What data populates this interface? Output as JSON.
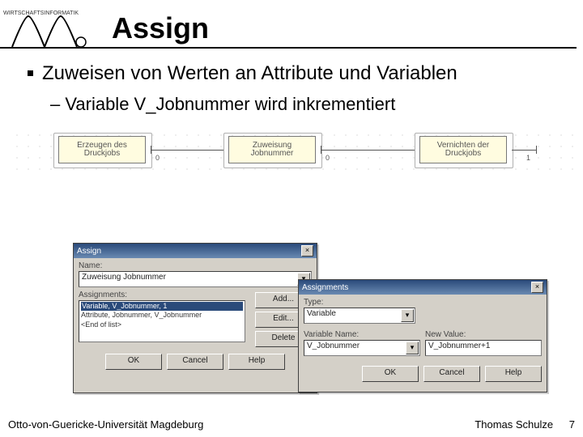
{
  "header": {
    "logo_text": "WIRTSCHAFTSINFORMATIK",
    "title": "Assign"
  },
  "body": {
    "main_bullet": "Zuweisen von Werten an Attribute und Variablen",
    "sub_bullet": "– Variable V_Jobnummer wird inkrementiert"
  },
  "flow": {
    "box1": "Erzeugen des Druckjobs",
    "box2": "Zuweisung Jobnummer",
    "box3": "Vernichten der Druckjobs",
    "zero": "0",
    "one": "1"
  },
  "dlg_assign": {
    "title": "Assign",
    "name_label": "Name:",
    "name_value": "Zuweisung Jobnummer",
    "assignments_label": "Assignments:",
    "list_sel": "Variable, V_Jobnummer, 1",
    "list_row2": "Attribute, Jobnummer, V_Jobnummer",
    "list_row3": "<End of list>",
    "btn_add": "Add...",
    "btn_edit": "Edit...",
    "btn_delete": "Delete",
    "btn_ok": "OK",
    "btn_cancel": "Cancel",
    "btn_help": "Help"
  },
  "dlg_assignments": {
    "title": "Assignments",
    "type_label": "Type:",
    "type_value": "Variable",
    "varname_label": "Variable Name:",
    "varname_value": "V_Jobnummer",
    "newval_label": "New Value:",
    "newval_value": "V_Jobnummer+1",
    "btn_ok": "OK",
    "btn_cancel": "Cancel",
    "btn_help": "Help"
  },
  "footer": {
    "left": "Otto-von-Guericke-Universität Magdeburg",
    "right": "Thomas Schulze",
    "page": "7"
  }
}
